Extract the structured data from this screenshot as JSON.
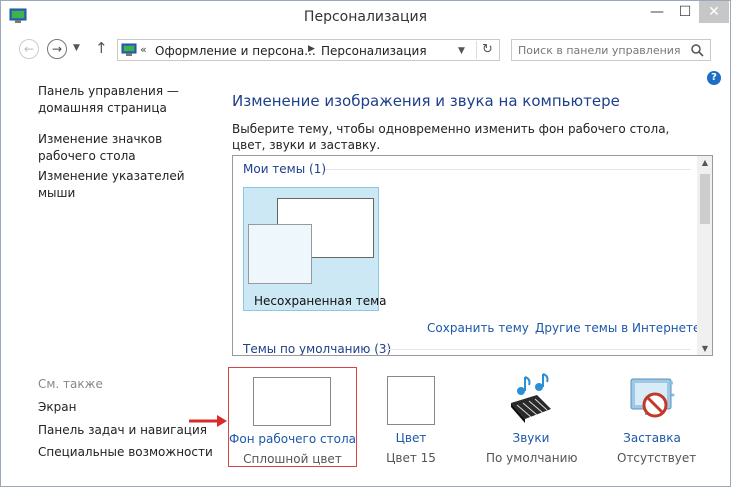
{
  "window": {
    "title": "Персонализация",
    "controls": {
      "minimize": "—",
      "maximize": "☐",
      "close": "✕"
    }
  },
  "address": {
    "back": "←",
    "forward": "→",
    "up": "↑",
    "chevron": "«",
    "crumbs": [
      "Оформление и персона...",
      "Персонализация"
    ],
    "refresh": "↻",
    "search_placeholder": "Поиск в панели управления"
  },
  "help": "?",
  "sidebar": {
    "links": [
      "Панель управления — домашняя страница",
      "Изменение значков рабочего стола",
      "Изменение указателей мыши"
    ],
    "see_also_title": "См. также",
    "see_also": [
      "Экран",
      "Панель задач и навигация",
      "Специальные возможности"
    ]
  },
  "main": {
    "heading": "Изменение изображения и звука на компьютере",
    "description": "Выберите тему, чтобы одновременно изменить фон рабочего стола, цвет, звуки и заставку.",
    "my_themes": "Мои темы (1)",
    "unsaved_theme": "Несохраненная тема",
    "save_theme": "Сохранить тему",
    "more_themes": "Другие темы в Интернете",
    "default_themes": "Темы по умолчанию (3)"
  },
  "bottom": {
    "background": {
      "title": "Фон рабочего стола",
      "sub": "Сплошной цвет"
    },
    "color": {
      "title": "Цвет",
      "sub": "Цвет 15"
    },
    "sounds": {
      "title": "Звуки",
      "sub": "По умолчанию"
    },
    "screensaver": {
      "title": "Заставка",
      "sub": "Отсутствует"
    }
  },
  "colors": {
    "heading": "#1e3f8a",
    "link": "#1c58a8",
    "selection": "#cce8f4",
    "highlight_border": "#d94545",
    "arrow": "#d92b2b"
  }
}
